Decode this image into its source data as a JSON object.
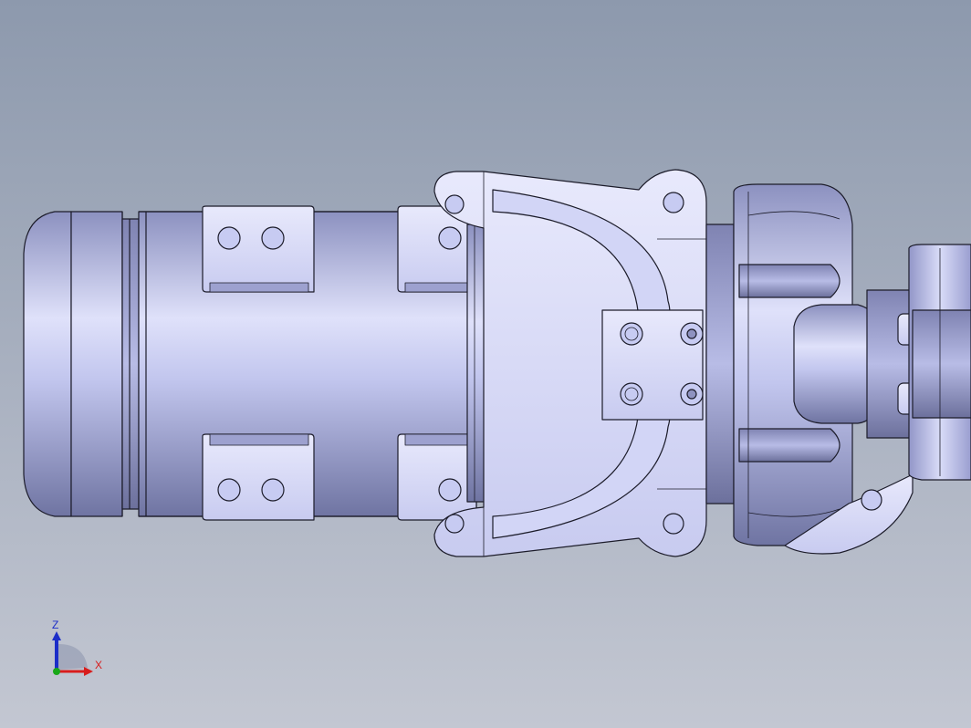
{
  "viewport": {
    "background_top": "#8d99ad",
    "background_bottom": "#c3c7d2",
    "model_fill_light": "#e4e6fb",
    "model_fill_mid": "#b4b8e4",
    "model_fill_dark": "#7479a6",
    "edge_color": "#1c1c2a"
  },
  "triad": {
    "z_label": "Z",
    "x_label": "X",
    "z_color": "#1c2ec8",
    "x_color": "#d81c1c",
    "y_color": "#18a818"
  }
}
